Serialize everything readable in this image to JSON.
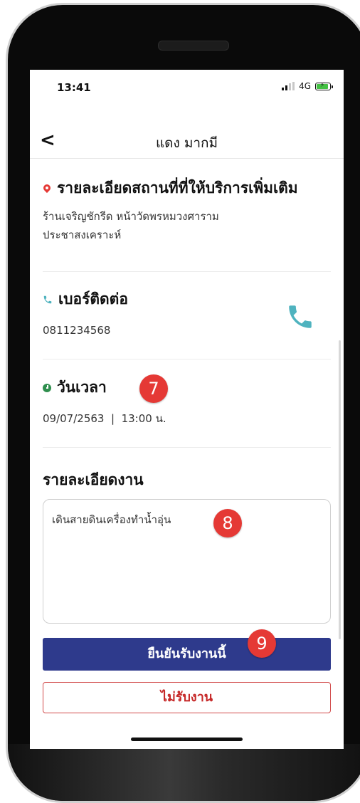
{
  "status_bar": {
    "time": "13:41",
    "network": "4G"
  },
  "header": {
    "title": "แดง มากมี"
  },
  "location": {
    "heading": "รายละเอียดสถานที่ที่ให้บริการเพิ่มเติม",
    "line1": "ร้านเจริญชักรีด หน้าวัดพรหมวงศาราม",
    "line2": "ประชาสงเคราะห์"
  },
  "contact": {
    "heading": "เบอร์ติดต่อ",
    "phone": "0811234568"
  },
  "datetime": {
    "heading": "วันเวลา",
    "value": "09/07/2563  |  13:00 น."
  },
  "job": {
    "heading": "รายละเอียดงาน",
    "text": "เดินสายดินเครื่องทำน้ำอุ่น"
  },
  "buttons": {
    "confirm": "ยืนยันรับงานนี้",
    "reject": "ไม่รับงาน"
  },
  "badges": {
    "b7": "7",
    "b8": "8",
    "b9": "9"
  },
  "colors": {
    "primary": "#2e3a8c",
    "reject": "#c62828",
    "badge": "#e53935",
    "phone_icon": "#4fb3bf"
  }
}
